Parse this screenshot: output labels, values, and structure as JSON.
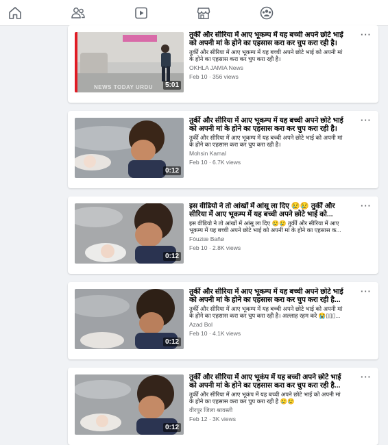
{
  "nav": {
    "items": [
      {
        "name": "home-icon"
      },
      {
        "name": "friends-icon"
      },
      {
        "name": "watch-icon"
      },
      {
        "name": "marketplace-icon"
      },
      {
        "name": "groups-icon"
      }
    ]
  },
  "videos": [
    {
      "title_1": "तुर्की और सीरिया में आए भूकम्प में यह बच्ची अपने छोटे भाई",
      "title_2": "को अपनी मां के होने का एहसास करा कर चुप करा रही है।",
      "desc_1": "तुर्की और सीरिया में आए भूकम्प में यह बच्ची अपने छोटे भाई को अपनी मां",
      "desc_2": "के होने का एहसास करा कर चुप करा रही है।",
      "channel": "OKHLA JAMIA News",
      "meta": "Feb 10 · 356 views",
      "duration": "5:01",
      "overlay": "NEWS TODAY URDU"
    },
    {
      "title_1": "तुर्की और सीरिया में आए भूकम्प में यह बच्ची अपने छोटे भाई",
      "title_2": "को अपनी मां के होने का एहसास करा कर चुप करा रही है।",
      "desc_1": "तुर्की और सीरिया में आए भूकम्प में यह बच्ची अपने छोटे भाई को अपनी मां",
      "desc_2": "के होने का एहसास करा कर चुप करा रही है।",
      "channel": "Mohsin Kamal",
      "meta": "Feb 10 · 6.7K views",
      "duration": "0:12"
    },
    {
      "title_1": "इस वीडियो ने तो आंखों में आंसू ला दिए 😢😢 तुर्की और",
      "title_2": "सीरिया में आए भूकम्प में यह बच्ची अपने छोटे भाई को...",
      "desc_1": "इस वीडियो ने तो आंखों में आंसू ला दिए 😢😢 तुर्की और सीरिया में आए",
      "desc_2": "भूकम्प में यह बच्ची अपने छोटे भाई को अपनी मां के होने का एहसास क...",
      "channel": "Fòuziæ Bañø",
      "meta": "Feb 10 · 2.8K views",
      "duration": "0:12"
    },
    {
      "title_1": "तुर्की और सीरिया में आए भूकम्प में यह बच्ची अपने छोटे भाई",
      "title_2": "को अपनी मां के होने का एहसास करा कर चुप करा रही है...",
      "desc_1": "तुर्की और सीरिया में आए भूकम्प में यह बच्ची अपने छोटे भाई को अपनी मां",
      "desc_2": "के होने का एहसास करा कर चुप करा रही है। अल्लाह रहम करे 😭▯▯▯...",
      "channel": "Azad Bol",
      "meta": "Feb 10 · 4.1K views",
      "duration": "0:12"
    },
    {
      "title_1": "तुर्की और सीरिया में आए भूकंप में यह बच्ची अपने छोटे भाई",
      "title_2": "को अपनी मां के होने का एहसास करा कर चुप करा रही है...",
      "desc_1": "तुर्की और सीरिया में आए भूकंप में यह बच्ची अपने छोटे भाई को अपनी मां",
      "desc_2": "के होने का एहसास करा कर चुप करा रही है 😢😢",
      "channel": "वीरपुर जिला श्रावस्ती",
      "meta": "Feb 12 · 3K views",
      "duration": "0:12"
    }
  ]
}
